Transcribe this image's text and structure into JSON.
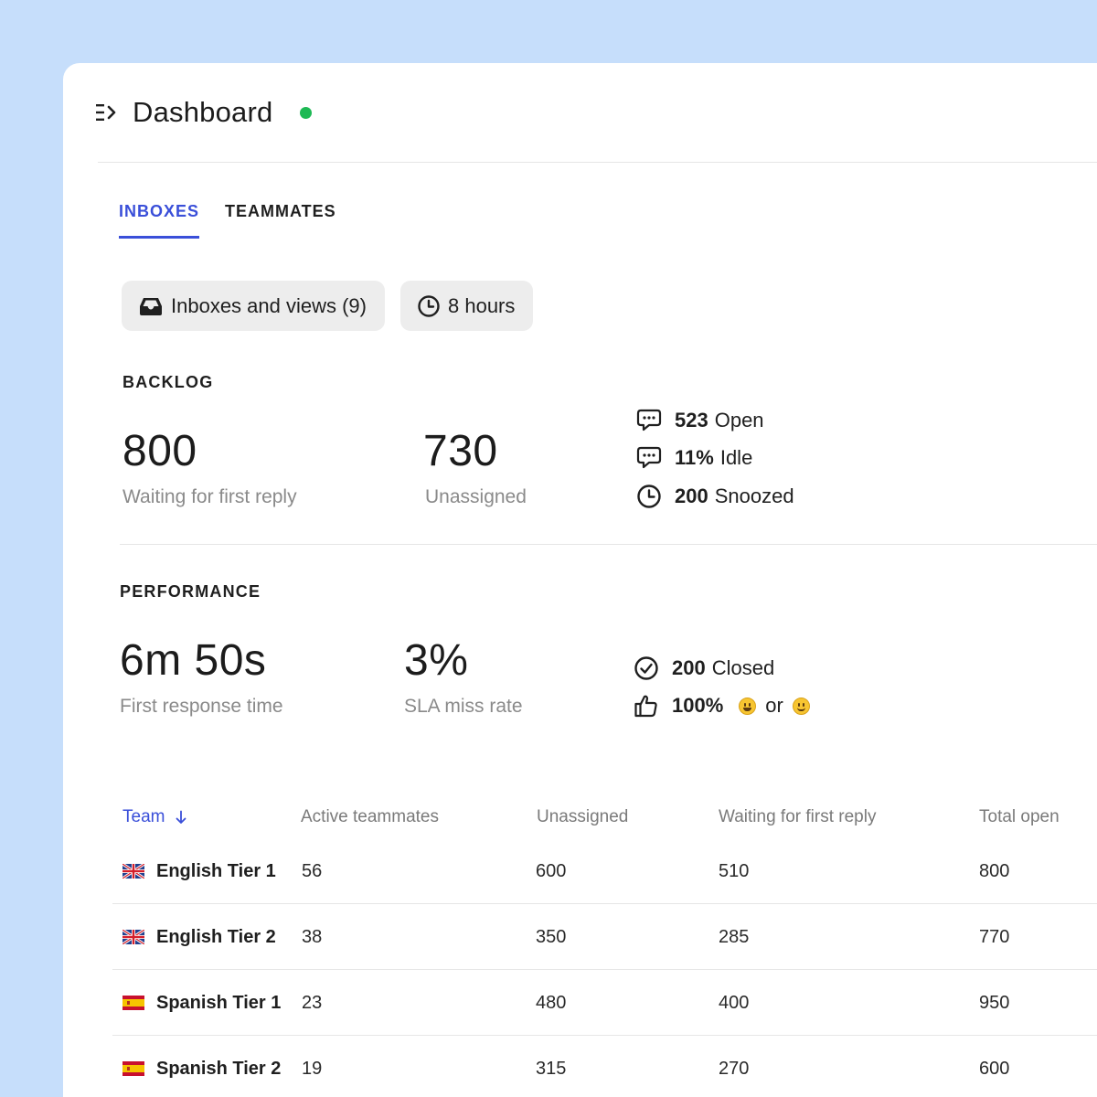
{
  "header": {
    "title": "Dashboard",
    "status_color": "#1db954"
  },
  "tabs": [
    {
      "label": "INBOXES",
      "active": true
    },
    {
      "label": "TEAMMATES",
      "active": false
    }
  ],
  "filters": {
    "inboxes_label": "Inboxes and views (9)",
    "time_label": "8 hours"
  },
  "backlog": {
    "label": "BACKLOG",
    "waiting_value": "800",
    "waiting_label": "Waiting for first reply",
    "unassigned_value": "730",
    "unassigned_label": "Unassigned",
    "open_value": "523",
    "open_label": "Open",
    "idle_value": "11%",
    "idle_label": "Idle",
    "snoozed_value": "200",
    "snoozed_label": "Snoozed"
  },
  "performance": {
    "label": "PERFORMANCE",
    "frt_value": "6m 50s",
    "frt_label": "First response time",
    "sla_value": "3%",
    "sla_label": "SLA miss rate",
    "closed_value": "200",
    "closed_label": "Closed",
    "csat_value": "100%",
    "csat_or": "or"
  },
  "table": {
    "columns": [
      "Team",
      "Active teammates",
      "Unassigned",
      "Waiting for first reply",
      "Total open"
    ],
    "rows": [
      {
        "team": "English Tier 1",
        "flag": "uk-flag",
        "active": "56",
        "unassigned": "600",
        "waiting": "510",
        "total": "800"
      },
      {
        "team": "English Tier 2",
        "flag": "uk-flag",
        "active": "38",
        "unassigned": "350",
        "waiting": "285",
        "total": "770"
      },
      {
        "team": "Spanish Tier 1",
        "flag": "spain-flag",
        "active": "23",
        "unassigned": "480",
        "waiting": "400",
        "total": "950"
      },
      {
        "team": "Spanish Tier 2",
        "flag": "spain-flag",
        "active": "19",
        "unassigned": "315",
        "waiting": "270",
        "total": "600"
      }
    ]
  }
}
